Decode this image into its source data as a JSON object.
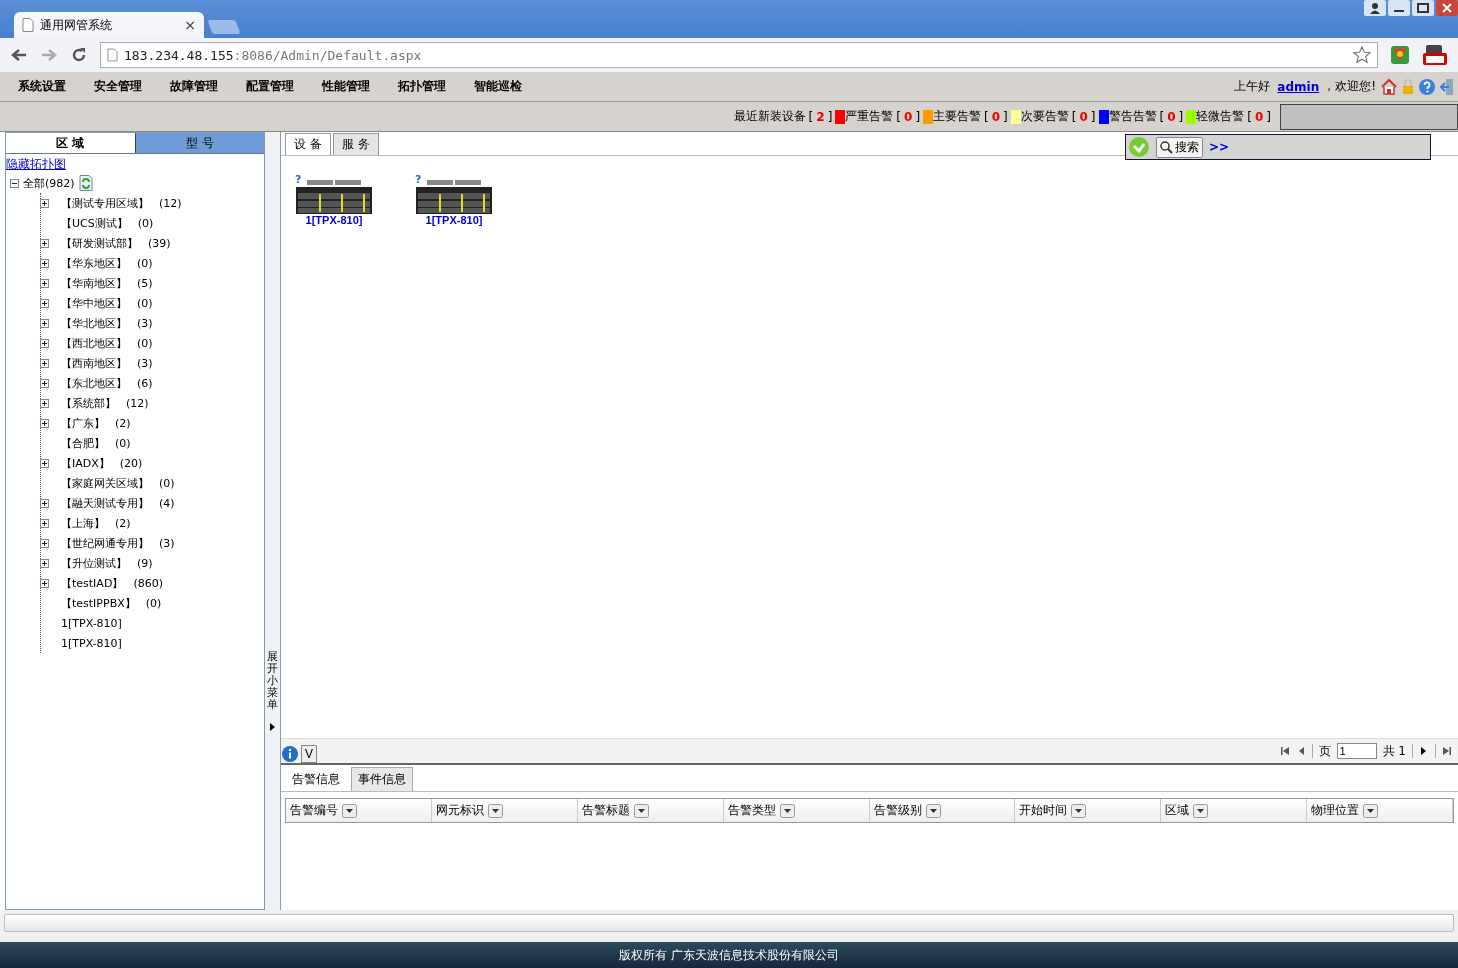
{
  "browser": {
    "tab_title": "通用网管系统",
    "url_host": "183.234.48.155",
    "url_path": ":8086/Admin/Default.aspx",
    "close": "×"
  },
  "menu": [
    "系统设置",
    "安全管理",
    "故障管理",
    "配置管理",
    "性能管理",
    "拓扑管理",
    "智能巡检"
  ],
  "greeting": {
    "text": "上午好",
    "user": "admin",
    "welcome": "，欢迎您!"
  },
  "alarm_summary": [
    {
      "label": "最近新装设备",
      "open": "[",
      "count": "2",
      "close": "]"
    },
    {
      "label": "严重告警",
      "open": "[",
      "count": "0",
      "close": "]",
      "color": "#ff0000"
    },
    {
      "label": "主要告警",
      "open": "[",
      "count": "0",
      "close": "]",
      "color": "#ff9900"
    },
    {
      "label": "次要告警",
      "open": "[",
      "count": "0",
      "close": "]",
      "color": "#ffff99"
    },
    {
      "label": "警告告警",
      "open": "[",
      "count": "0",
      "close": "]",
      "color": "#0000ff"
    },
    {
      "label": "轻微告警",
      "open": "[",
      "count": "0",
      "close": "]",
      "color": "#99ff00"
    }
  ],
  "search": {
    "button": "搜索",
    "more": ">>"
  },
  "left_tabs": [
    {
      "label": "区 域",
      "selected": true
    },
    {
      "label": "型 号",
      "selected": false
    }
  ],
  "hide_link": "隐藏拓扑图",
  "tree": {
    "label": "全部",
    "count": "(982)",
    "expanded": true,
    "children": [
      {
        "label": "【测试专用区域】",
        "count": "(12)",
        "expandable": true
      },
      {
        "label": "【UCS测试】",
        "count": "(0)",
        "expandable": false
      },
      {
        "label": "【研发测试部】",
        "count": "(39)",
        "expandable": true
      },
      {
        "label": "【华东地区】",
        "count": "(0)",
        "expandable": true
      },
      {
        "label": "【华南地区】",
        "count": "(5)",
        "expandable": true
      },
      {
        "label": "【华中地区】",
        "count": "(0)",
        "expandable": true
      },
      {
        "label": "【华北地区】",
        "count": "(3)",
        "expandable": true
      },
      {
        "label": "【西北地区】",
        "count": "(0)",
        "expandable": true
      },
      {
        "label": "【西南地区】",
        "count": "(3)",
        "expandable": true
      },
      {
        "label": "【东北地区】",
        "count": "(6)",
        "expandable": true
      },
      {
        "label": "【系统部】",
        "count": "(12)",
        "expandable": true
      },
      {
        "label": "【广东】",
        "count": "(2)",
        "expandable": true
      },
      {
        "label": "【合肥】",
        "count": "(0)",
        "expandable": false
      },
      {
        "label": "【IADX】",
        "count": "(20)",
        "expandable": true
      },
      {
        "label": "【家庭网关区域】",
        "count": "(0)",
        "expandable": false
      },
      {
        "label": "【融天测试专用】",
        "count": "(4)",
        "expandable": true
      },
      {
        "label": "【上海】",
        "count": "(2)",
        "expandable": true
      },
      {
        "label": "【世纪网通专用】",
        "count": "(3)",
        "expandable": true
      },
      {
        "label": "【升位测试】",
        "count": "(9)",
        "expandable": true
      },
      {
        "label": "【testIAD】",
        "count": "(860)",
        "expandable": true
      },
      {
        "label": "【testIPPBX】",
        "count": "(0)",
        "expandable": false
      },
      {
        "label": "1[TPX-810]",
        "expandable": false
      },
      {
        "label": "1[TPX-810]",
        "expandable": false
      }
    ]
  },
  "splitter": "展开小菜单",
  "right_tabs": [
    {
      "label": "设 备",
      "selected": true
    },
    {
      "label": "服 务",
      "selected": false
    }
  ],
  "devices": [
    {
      "label": "1[TPX-810]",
      "status": "?"
    },
    {
      "label": "1[TPX-810]",
      "status": "?"
    }
  ],
  "pager": {
    "v_button": "V",
    "page": "页",
    "value": "1",
    "total": "共 1"
  },
  "bottom_tabs": [
    {
      "label": "告警信息",
      "selected": true
    },
    {
      "label": "事件信息",
      "selected": false
    }
  ],
  "columns": [
    "告警编号",
    "网元标识",
    "告警标题",
    "告警类型",
    "告警级别",
    "开始时间",
    "区域",
    "物理位置"
  ],
  "footer": "版权所有 广东天波信息技术股份有限公司"
}
